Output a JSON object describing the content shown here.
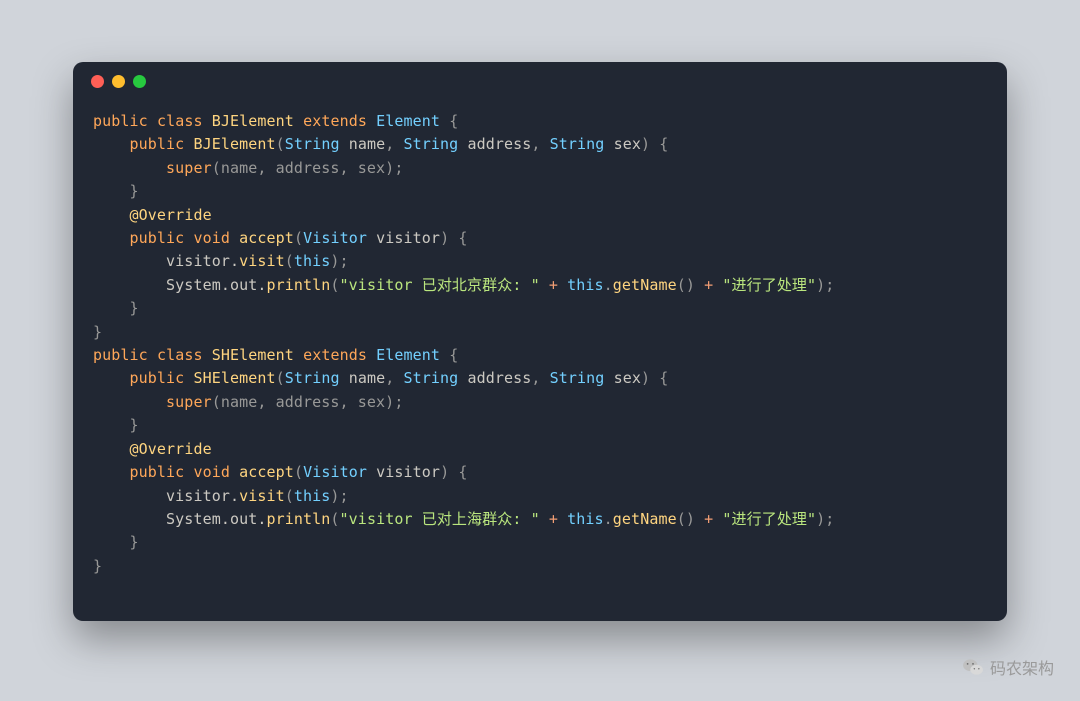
{
  "traffic": {
    "red": "red",
    "yellow": "yellow",
    "green": "green"
  },
  "code": {
    "l01a": "public",
    "l01b": "class",
    "l01c": "BJElement",
    "l01d": "extends",
    "l01e": "Element",
    "l01f": "{",
    "l02a": "    ",
    "l02b": "public",
    "l02c": "BJElement",
    "l02d": "(",
    "l02e": "String",
    "l02f": "name",
    "l02g": ", ",
    "l02h": "String",
    "l02i": "address",
    "l02j": ", ",
    "l02k": "String",
    "l02l": "sex",
    "l02m": ") {",
    "l03a": "        ",
    "l03b": "super",
    "l03c": "(name, address, sex);",
    "l04a": "    }",
    "l05a": "    ",
    "l05b": "@Override",
    "l06a": "    ",
    "l06b": "public",
    "l06c": "void",
    "l06d": "accept",
    "l06e": "(",
    "l06f": "Visitor",
    "l06g": "visitor",
    "l06h": ") {",
    "l07a": "        visitor.",
    "l07b": "visit",
    "l07c": "(",
    "l07d": "this",
    "l07e": ");",
    "l08a": "        System.out.",
    "l08b": "println",
    "l08c": "(",
    "l08d": "\"visitor 已对北京群众: \"",
    "l08e": " + ",
    "l08f": "this",
    "l08g": ".",
    "l08h": "getName",
    "l08i": "() ",
    "l08j": "+",
    "l08k": " ",
    "l08l": "\"进行了处理\"",
    "l08m": ");",
    "l09a": "    }",
    "l10a": "}",
    "l11a": "public",
    "l11b": "class",
    "l11c": "SHElement",
    "l11d": "extends",
    "l11e": "Element",
    "l11f": "{",
    "l12a": "    ",
    "l12b": "public",
    "l12c": "SHElement",
    "l12d": "(",
    "l12e": "String",
    "l12f": "name",
    "l12g": ", ",
    "l12h": "String",
    "l12i": "address",
    "l12j": ", ",
    "l12k": "String",
    "l12l": "sex",
    "l12m": ") {",
    "l13a": "        ",
    "l13b": "super",
    "l13c": "(name, address, sex);",
    "l14a": "    }",
    "l15a": "    ",
    "l15b": "@Override",
    "l16a": "    ",
    "l16b": "public",
    "l16c": "void",
    "l16d": "accept",
    "l16e": "(",
    "l16f": "Visitor",
    "l16g": "visitor",
    "l16h": ") {",
    "l17a": "        visitor.",
    "l17b": "visit",
    "l17c": "(",
    "l17d": "this",
    "l17e": ");",
    "l18a": "        System.out.",
    "l18b": "println",
    "l18c": "(",
    "l18d": "\"visitor 已对上海群众: \"",
    "l18e": " + ",
    "l18f": "this",
    "l18g": ".",
    "l18h": "getName",
    "l18i": "() ",
    "l18j": "+",
    "l18k": " ",
    "l18l": "\"进行了处理\"",
    "l18m": ");",
    "l19a": "    }",
    "l20a": "}"
  },
  "watermark": "码农架构"
}
